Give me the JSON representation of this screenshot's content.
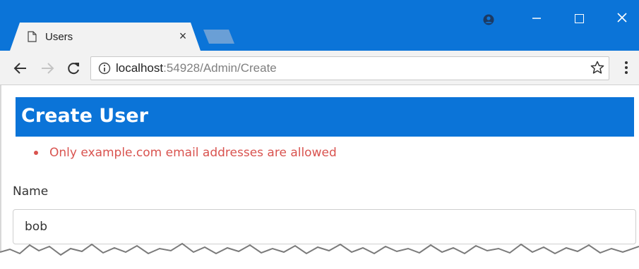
{
  "browser": {
    "tab": {
      "title": "Users",
      "close_label": "×"
    },
    "address_bar": {
      "host": "localhost",
      "path": ":54928/Admin/Create"
    },
    "icons": {
      "tab": "document-icon",
      "profile": "profile-icon",
      "minimize": "minimize-icon",
      "maximize": "maximize-icon",
      "close": "close-icon",
      "back": "back-arrow-icon",
      "forward": "forward-arrow-icon",
      "reload": "reload-icon",
      "site_info": "info-icon",
      "bookmark": "star-icon",
      "menu": "kebab-menu-icon"
    }
  },
  "page": {
    "title": "Create User",
    "validation_errors": [
      "Only example.com email addresses are allowed"
    ],
    "form": {
      "name_label": "Name",
      "name_value": "bob"
    }
  },
  "colors": {
    "accent": "#0b74d8",
    "error": "#d9534f"
  }
}
